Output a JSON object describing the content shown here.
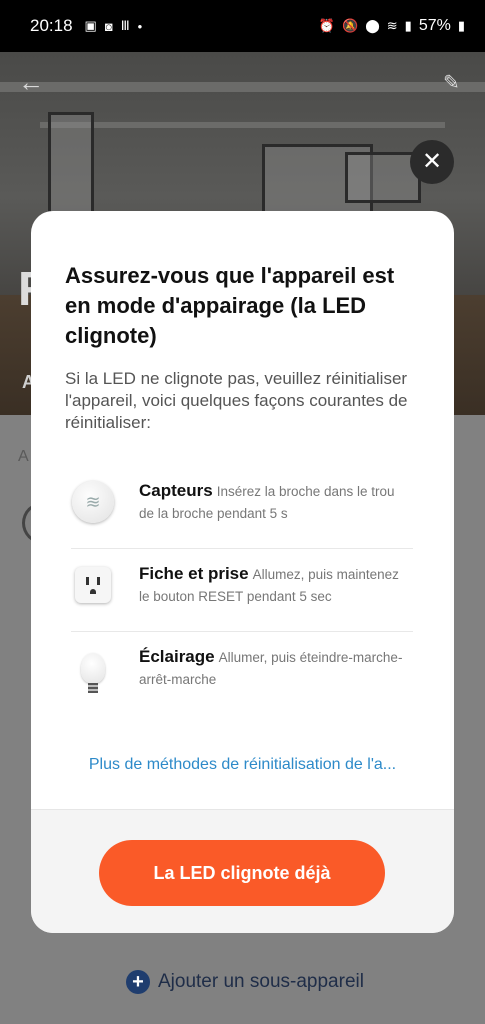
{
  "status_bar": {
    "time": "20:18",
    "battery": "57%",
    "left_icons": [
      "image-icon",
      "ring-icon",
      "m-icon",
      "dot-icon"
    ],
    "right_icons": [
      "alarm-icon",
      "mute-icon",
      "location-icon",
      "wifi-icon",
      "signal-icon",
      "battery-icon"
    ]
  },
  "background": {
    "hero_letter": "R",
    "hero_sub": "A",
    "lower_label": "A",
    "add_subdevice": "Ajouter un sous-appareil"
  },
  "modal": {
    "title": "Assurez-vous que l'appareil est en mode d'appairage (la LED clignote)",
    "description": "Si la LED ne clignote pas, veuillez réinitialiser l'appareil, voici quelques façons courantes de réinitialiser:",
    "methods": [
      {
        "name": "Capteurs",
        "text": "Insérez la broche dans le trou de la broche pendant 5 s",
        "icon": "sensor-icon"
      },
      {
        "name": "Fiche et prise",
        "text": "Allumez, puis maintenez le bouton RESET pendant 5 sec",
        "icon": "plug-icon"
      },
      {
        "name": "Éclairage",
        "text": "Allumer, puis éteindre-marche-arrêt-marche",
        "icon": "bulb-icon"
      }
    ],
    "more_link": "Plus de méthodes de réinitialisation de l'a...",
    "cta": "La LED clignote déjà"
  },
  "colors": {
    "accent": "#fa5a28",
    "link": "#2d8ac9"
  }
}
